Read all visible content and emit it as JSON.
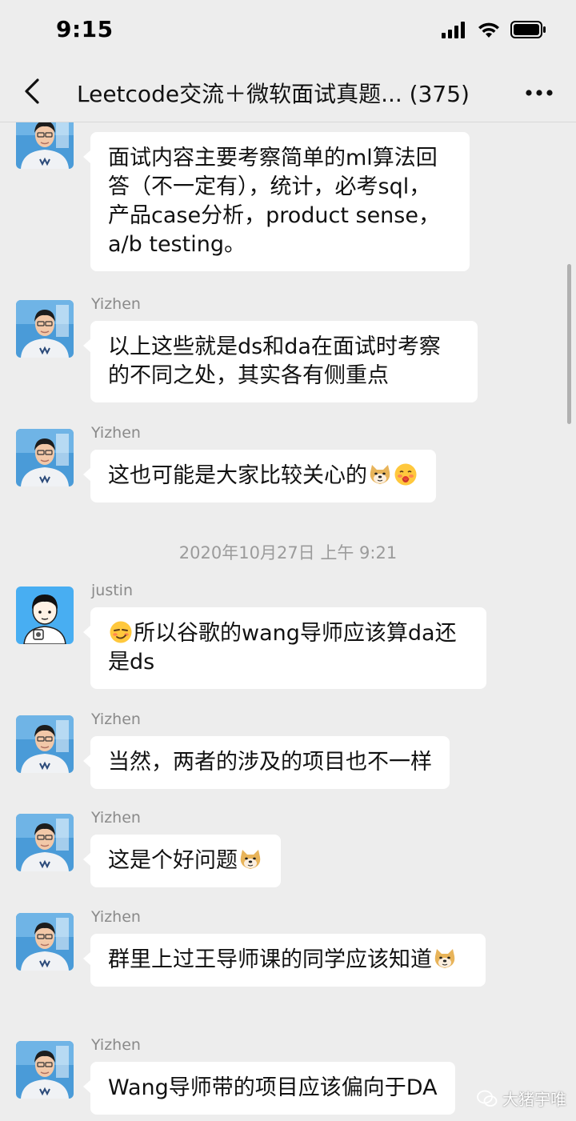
{
  "status_bar": {
    "time": "9:15",
    "icons": [
      "signal-icon",
      "wifi-icon",
      "battery-icon"
    ]
  },
  "nav": {
    "back_icon": "chevron-left-icon",
    "title": "Leetcode交流＋微软面试真题... (375)",
    "more_icon": "more-dots-icon"
  },
  "messages": [
    {
      "sender": "Yizhen",
      "avatar": "yizhen-photo",
      "parts": [
        {
          "t": "text",
          "v": "面试内容主要考察简单的ml算法回答（不一定有），统计，必考sql，产品case分析，product sense，a/b testing。"
        }
      ]
    },
    {
      "sender": "Yizhen",
      "avatar": "yizhen-photo",
      "parts": [
        {
          "t": "text",
          "v": "以上这些就是ds和da在面试时考察的不同之处，其实各有侧重点"
        }
      ]
    },
    {
      "sender": "Yizhen",
      "avatar": "yizhen-photo",
      "parts": [
        {
          "t": "text",
          "v": "这也可能是大家比较关心的"
        },
        {
          "t": "emoji",
          "v": "doge-emoji"
        },
        {
          "t": "emoji",
          "v": "blush-emoji"
        }
      ]
    },
    {
      "sender": "justin",
      "avatar": "cartoon-avatar",
      "parts": [
        {
          "t": "emoji",
          "v": "smirk-emoji"
        },
        {
          "t": "text",
          "v": "所以谷歌的wang导师应该算da还是ds"
        }
      ]
    },
    {
      "sender": "Yizhen",
      "avatar": "yizhen-photo",
      "parts": [
        {
          "t": "text",
          "v": "当然，两者的涉及的项目也不一样"
        }
      ]
    },
    {
      "sender": "Yizhen",
      "avatar": "yizhen-photo",
      "parts": [
        {
          "t": "text",
          "v": "这是个好问题"
        },
        {
          "t": "emoji",
          "v": "doge-emoji"
        }
      ]
    },
    {
      "sender": "Yizhen",
      "avatar": "yizhen-photo",
      "parts": [
        {
          "t": "text",
          "v": "群里上过王导师课的同学应该知道"
        },
        {
          "t": "emoji",
          "v": "doge-emoji"
        }
      ]
    },
    {
      "sender": "Yizhen",
      "avatar": "yizhen-photo",
      "parts": [
        {
          "t": "text",
          "v": "Wang导师带的项目应该偏向于DA"
        }
      ]
    }
  ],
  "timestamp": "2020年10月27日 上午 9:21",
  "watermark": {
    "icon": "wechat-icon",
    "text": "大猪宇唯"
  },
  "colors": {
    "background": "#ededed",
    "bubble": "#ffffff",
    "sender": "#8a8a8a",
    "timestamp": "#9b9b9b",
    "avatar_bg": "#4a9bd8"
  }
}
